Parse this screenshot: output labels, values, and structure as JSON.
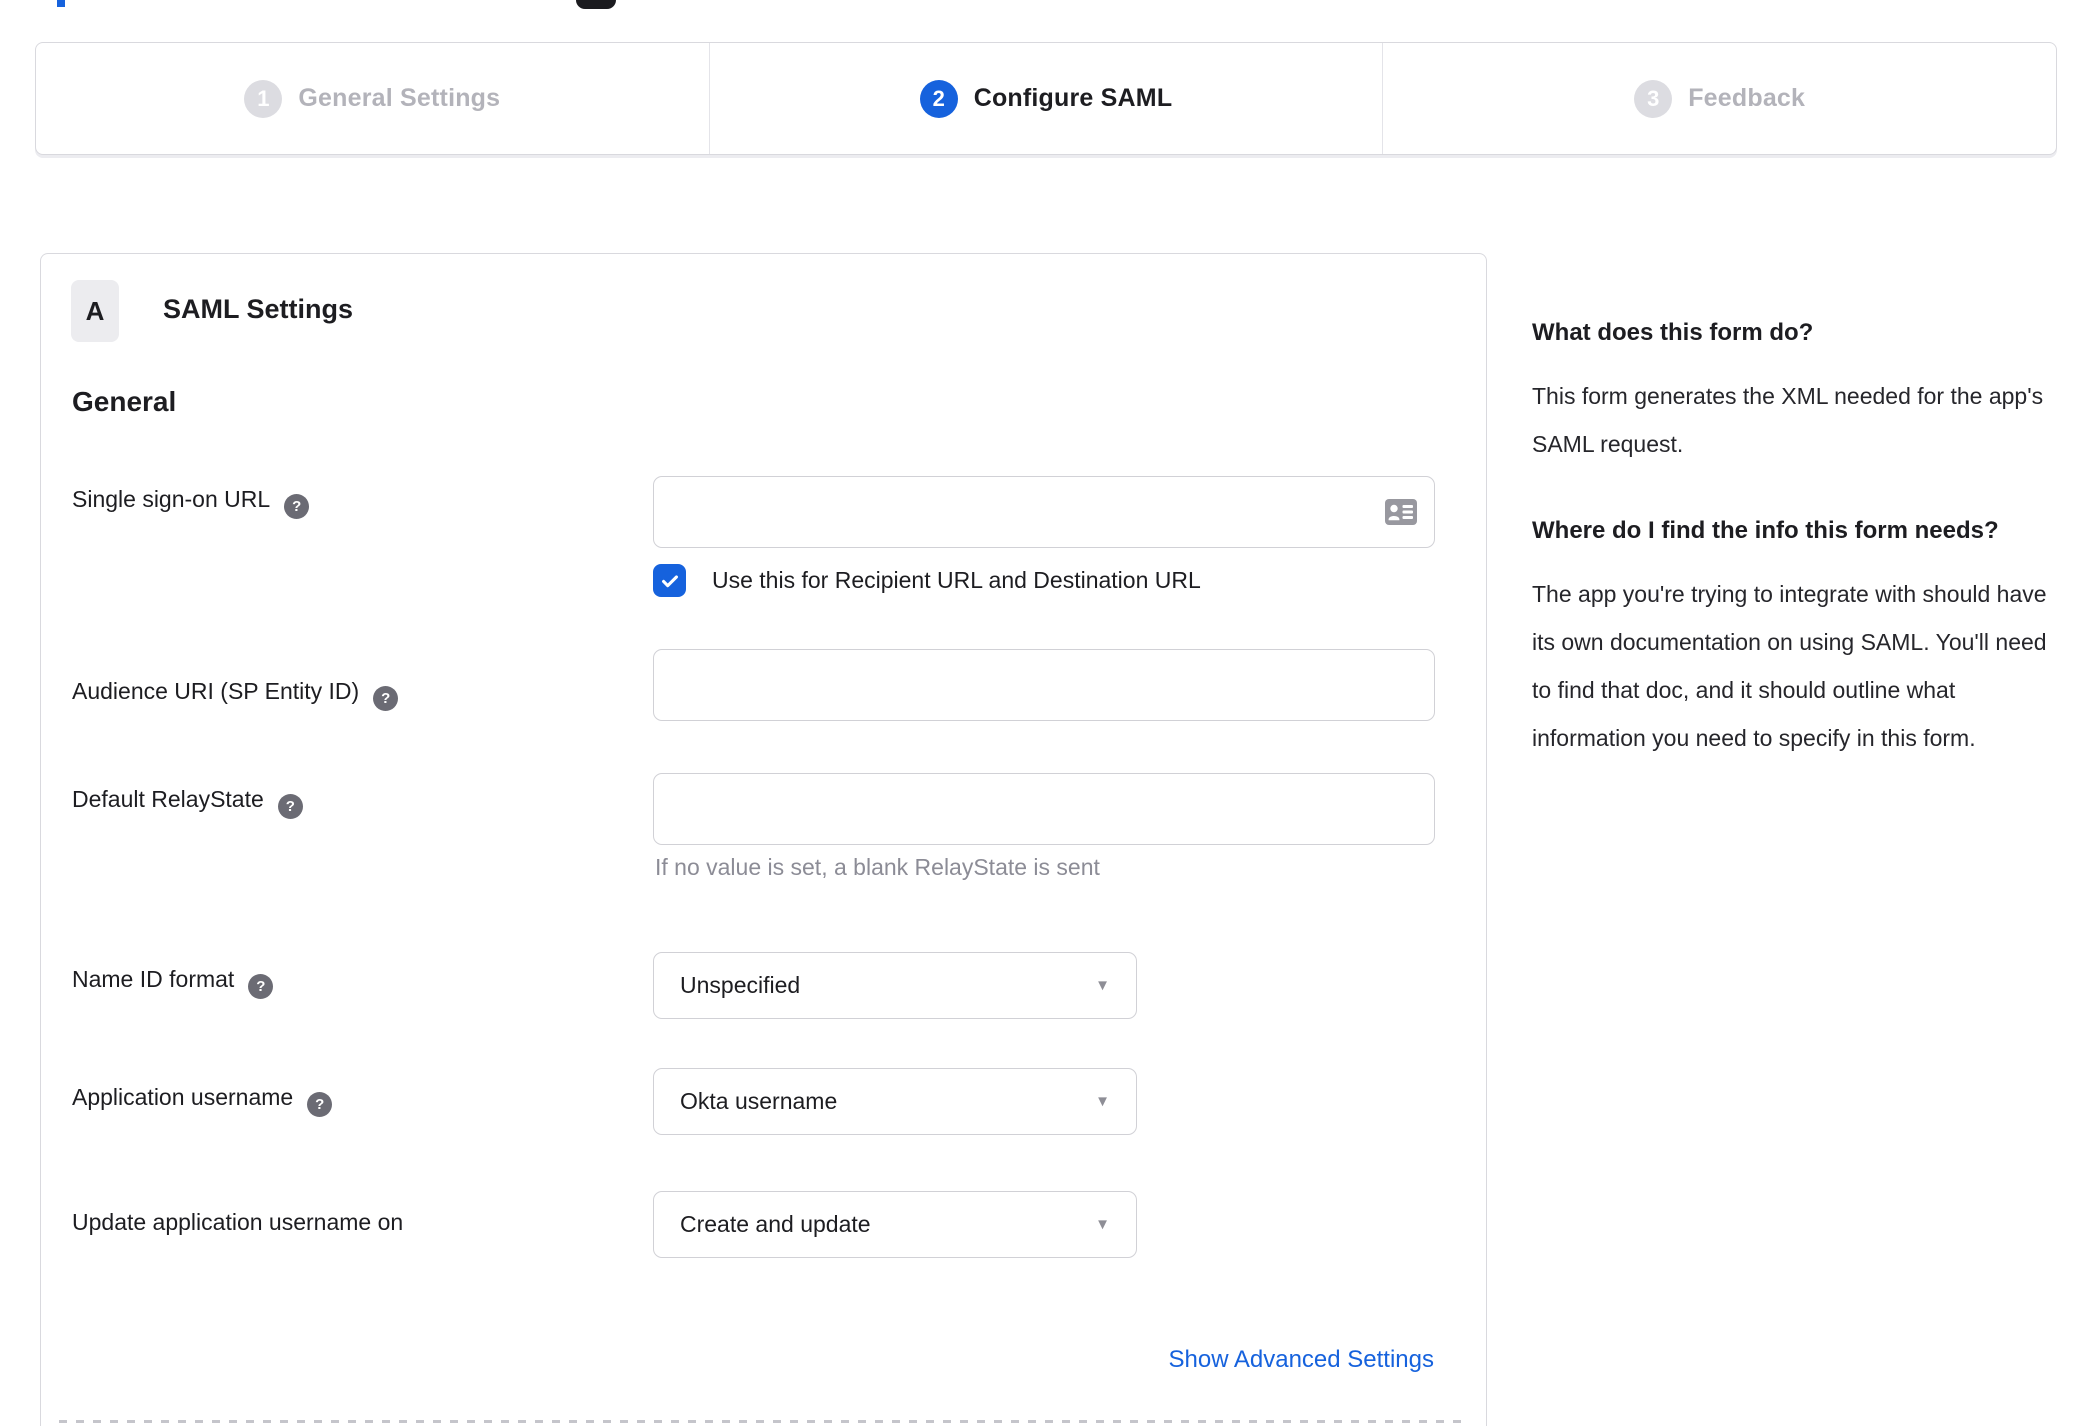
{
  "stepper": {
    "steps": [
      {
        "number": "1",
        "label": "General Settings",
        "state": "inactive"
      },
      {
        "number": "2",
        "label": "Configure SAML",
        "state": "active"
      },
      {
        "number": "3",
        "label": "Feedback",
        "state": "inactive"
      }
    ]
  },
  "panel": {
    "badge": "A",
    "title": "SAML Settings",
    "section_heading": "General",
    "fields": {
      "sso_url": {
        "label": "Single sign-on URL",
        "value": "",
        "checkbox_label": "Use this for Recipient URL and Destination URL",
        "checkbox_checked": true
      },
      "audience_uri": {
        "label": "Audience URI (SP Entity ID)",
        "value": ""
      },
      "relay_state": {
        "label": "Default RelayState",
        "value": "",
        "hint": "If no value is set, a blank RelayState is sent"
      },
      "name_id_format": {
        "label": "Name ID format",
        "value": "Unspecified"
      },
      "app_username": {
        "label": "Application username",
        "value": "Okta username"
      },
      "update_app_username": {
        "label": "Update application username on",
        "value": "Create and update"
      }
    },
    "advanced_link": "Show Advanced Settings"
  },
  "sidebar": {
    "sections": [
      {
        "heading": "What does this form do?",
        "body": "This form generates the XML needed for the app's SAML request."
      },
      {
        "heading": "Where do I find the info this form needs?",
        "body": "The app you're trying to integrate with should have its own documentation on using SAML. You'll need to find that doc, and it should outline what information you need to specify in this form."
      }
    ]
  },
  "icons": {
    "help": "?",
    "caret": "▼"
  },
  "colors": {
    "accent": "#1662dd",
    "inactive_gray": "#b3b3ba",
    "border": "#d9d9de",
    "hint_gray": "#8c8c96"
  }
}
